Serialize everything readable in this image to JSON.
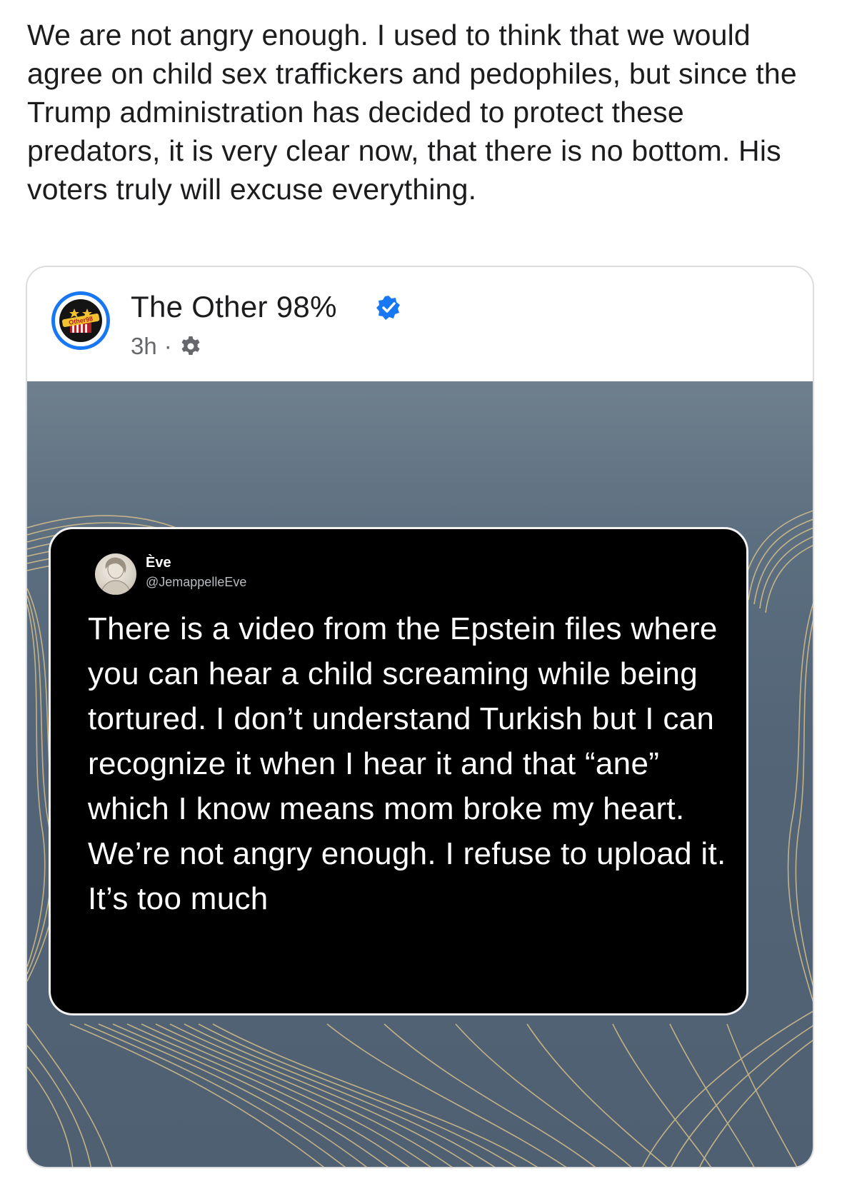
{
  "post": {
    "text": "We are not angry enough. I used to think that we would agree on child sex traffickers and pedophiles, but since the Trump administration has decided to protect these predators, it is very clear now, that there is no bottom. His voters truly will excuse everything."
  },
  "shared_post": {
    "page_name": "The Other 98%",
    "avatar_label": "Other98",
    "verified": true,
    "time": "3h",
    "separator": "·",
    "audience_icon": "gear-icon",
    "accent_color": "#1877f2"
  },
  "quoted_tweet": {
    "author": "Ève",
    "handle": "@JemappelleEve",
    "text": "There is a video from the Epstein files where you can hear a child screaming while being tortured. I don’t understand Turkish but I can recognize it when I hear it and that “ane” which I know means mom broke my heart. We’re not angry enough. I refuse to upload it. It’s too much"
  }
}
